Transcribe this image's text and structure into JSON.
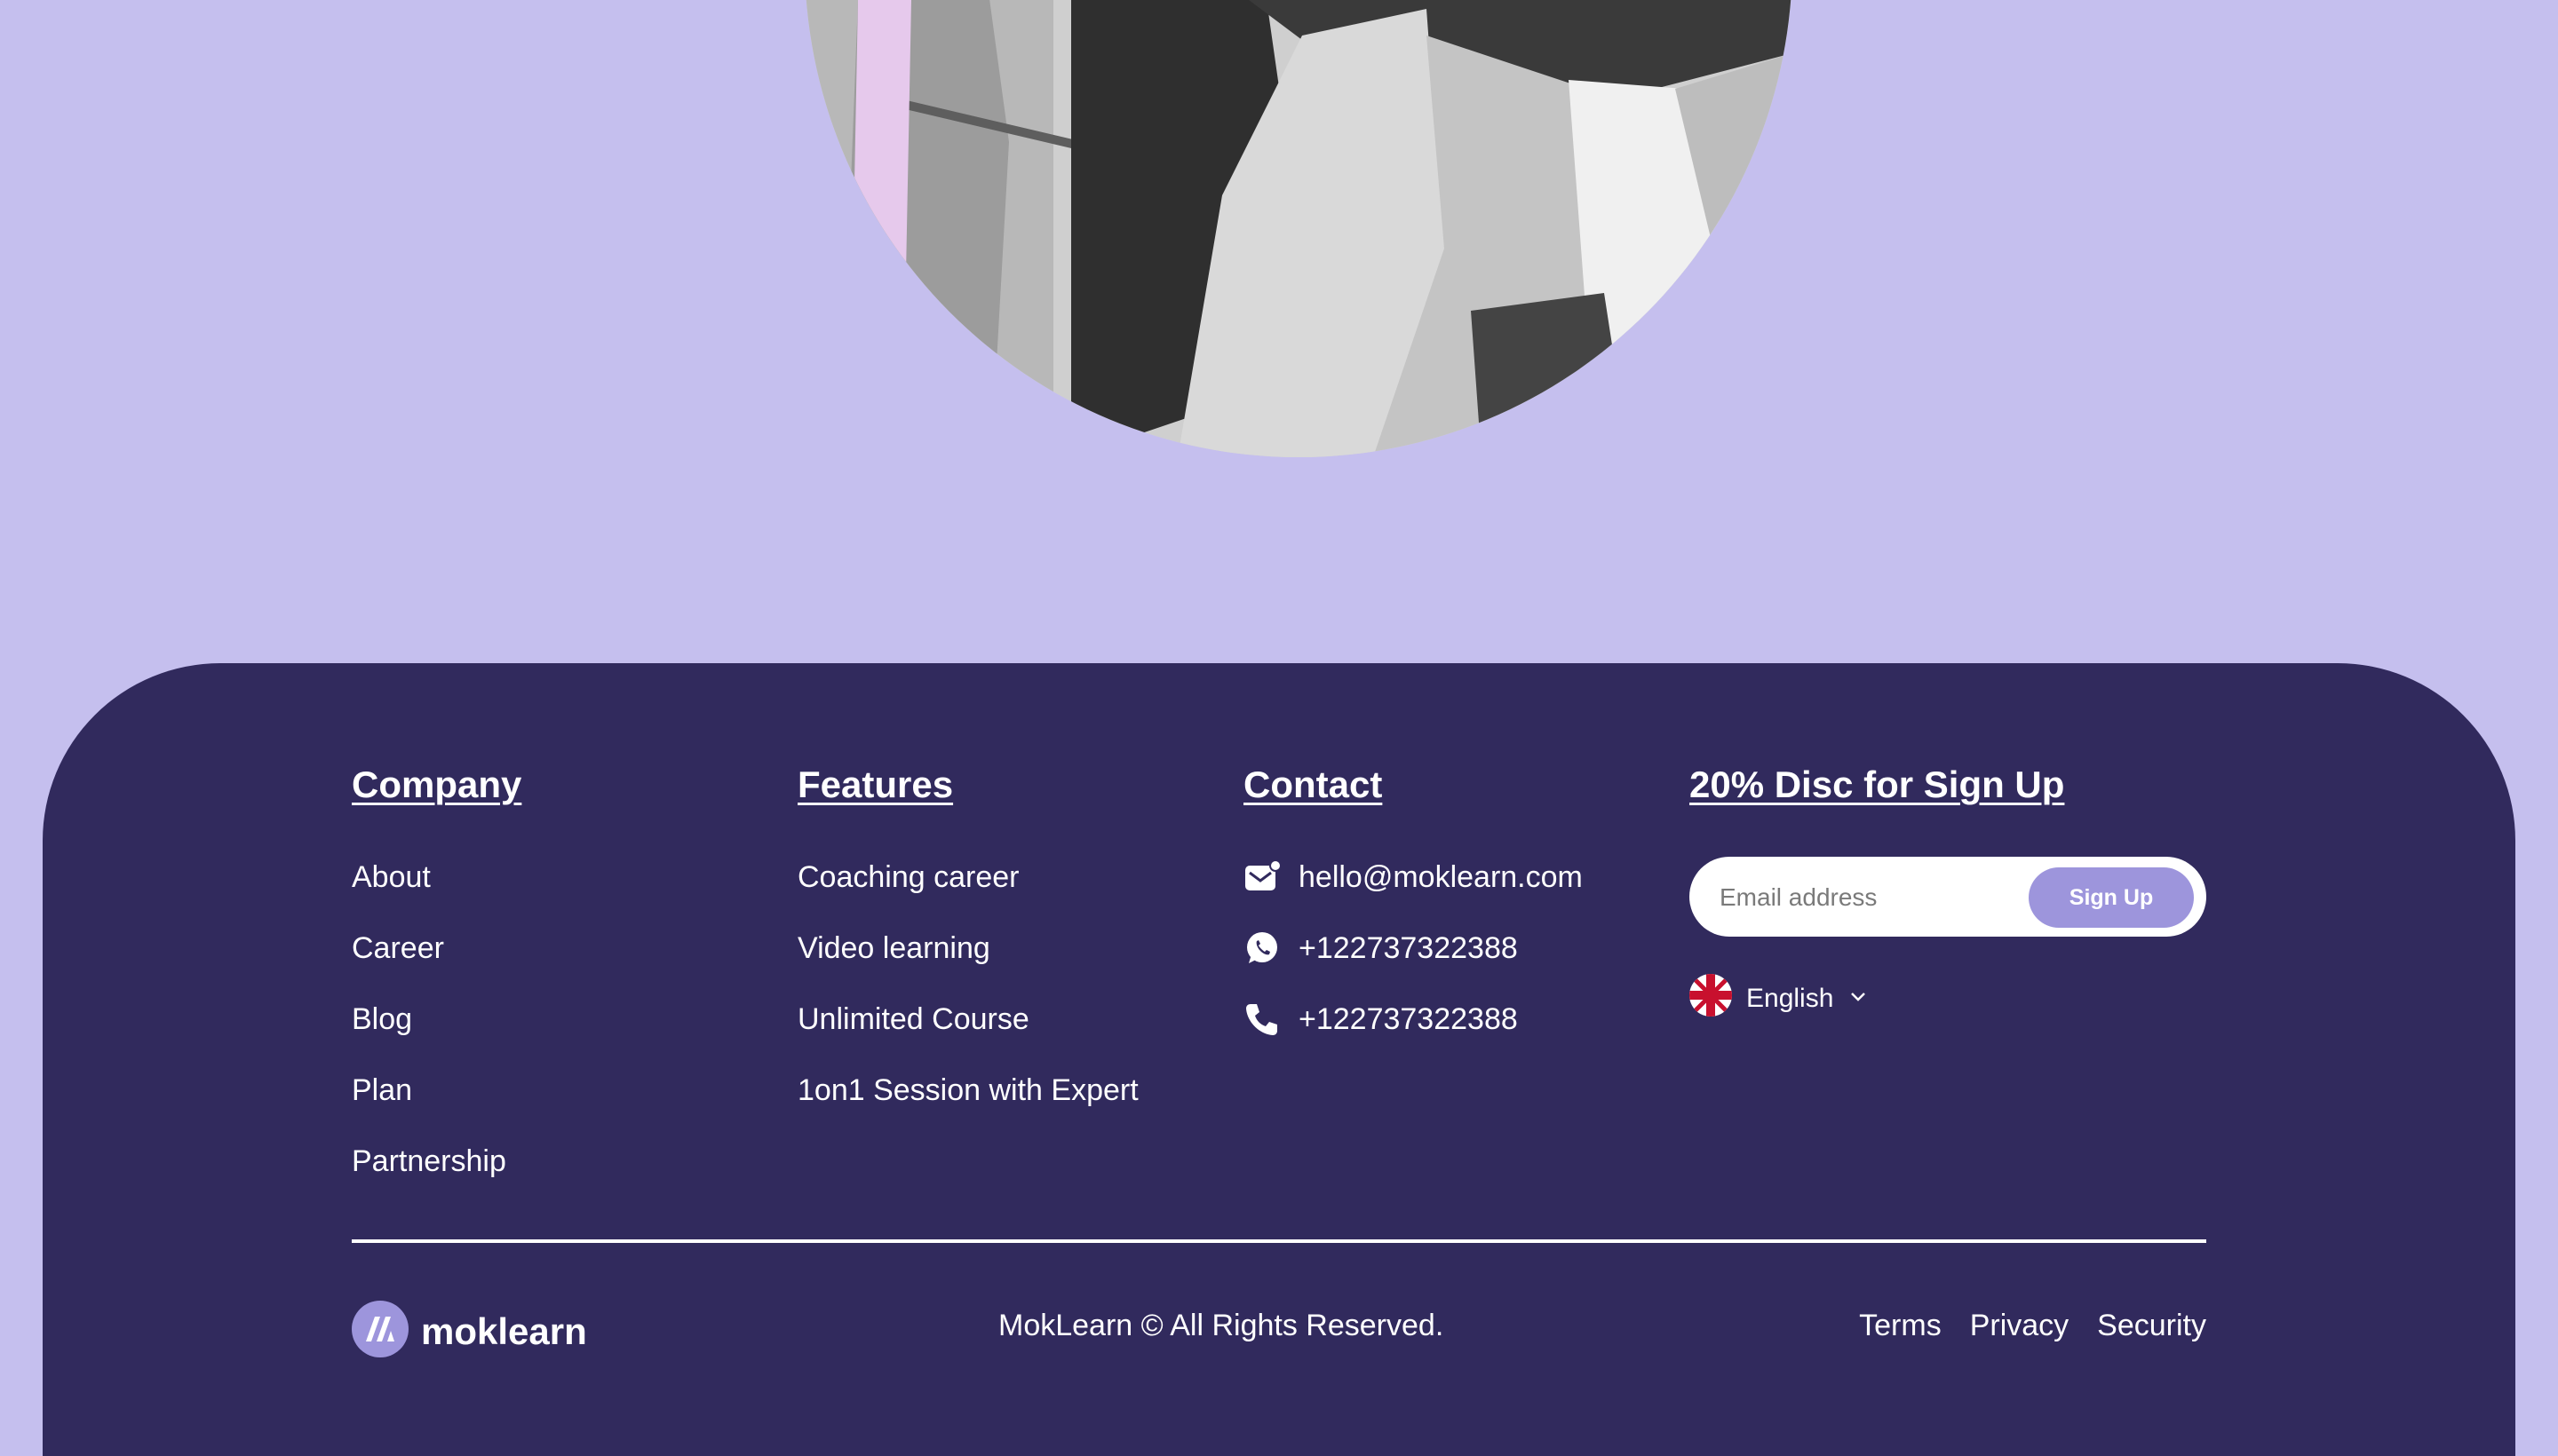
{
  "footer": {
    "company": {
      "title": "Company",
      "links": [
        "About",
        "Career",
        "Blog",
        "Plan",
        "Partnership"
      ]
    },
    "features": {
      "title": "Features",
      "links": [
        "Coaching career",
        "Video learning",
        "Unlimited Course",
        "1on1 Session with Expert"
      ]
    },
    "contact": {
      "title": "Contact",
      "email": "hello@moklearn.com",
      "whatsapp": "+122737322388",
      "phone": "+122737322388"
    },
    "signup": {
      "title": "20% Disc for Sign Up",
      "email_placeholder": "Email address",
      "email_value": "",
      "button_label": "Sign Up"
    },
    "language": {
      "selected": "English",
      "flag_icon": "uk-flag-icon"
    },
    "brand": {
      "name": "moklearn"
    },
    "copyright": "MokLearn © All Rights Reserved.",
    "legal_links": [
      "Terms",
      "Privacy",
      "Security"
    ]
  },
  "colors": {
    "page_background": "#c5bfee",
    "footer_background": "#312a5d",
    "accent": "#9d95dc",
    "text": "#ffffff"
  }
}
